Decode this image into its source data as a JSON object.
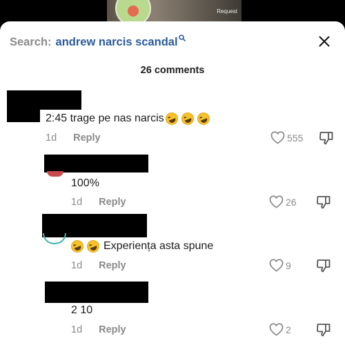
{
  "video": {
    "corner_label": "Request"
  },
  "search": {
    "prefix": "Search:",
    "query": "andrew narcis scandal"
  },
  "header": {
    "comments_count": "26 comments"
  },
  "comments": [
    {
      "text": "2:45 trage pe nas narcis",
      "emoji_count": 3,
      "time": "1d",
      "reply": "Reply",
      "likes": "555"
    },
    {
      "text": "100%",
      "emoji_count": 0,
      "time": "1d",
      "reply": "Reply",
      "likes": "26"
    },
    {
      "text": "Experiența asta spune",
      "emoji_count": 2,
      "time": "1d",
      "reply": "Reply",
      "likes": "9"
    },
    {
      "text": "2 10",
      "emoji_count": 0,
      "time": "1d",
      "reply": "Reply",
      "likes": "2"
    }
  ],
  "icons": {
    "search": "search-icon",
    "close": "close-icon",
    "like": "heart-outline-icon",
    "dislike": "thumbs-down-outline-icon",
    "emoji": "rolling-laughing-emoji"
  },
  "colors": {
    "query": "#2b5a9a",
    "muted": "#8a8a8a",
    "text": "#1c1c1c"
  }
}
